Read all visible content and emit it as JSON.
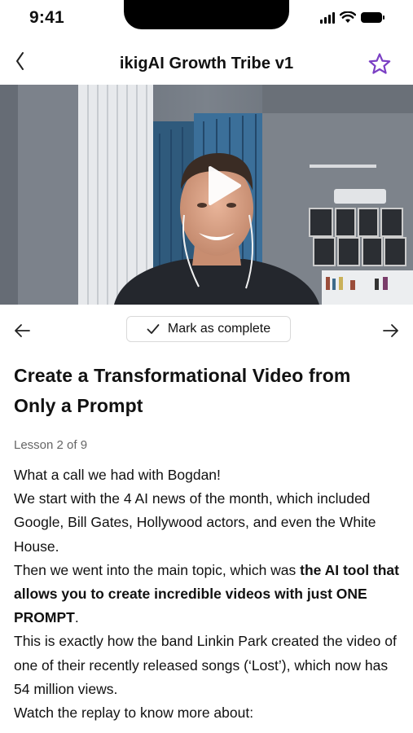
{
  "status_bar": {
    "time": "9:41"
  },
  "nav": {
    "title": "ikigAI Growth Tribe v1"
  },
  "controls": {
    "mark_complete_label": "Mark as complete"
  },
  "lesson": {
    "title": "Create a Transformational Video from Only a Prompt",
    "count": "Lesson 2 of 9",
    "paragraphs": {
      "p1": "What a call we had with Bogdan!",
      "p2": "We start with the 4 AI news of the month, which included Google, Bill Gates, Hollywood actors, and even the White House.",
      "p3_a": "Then we went into the main topic, which was ",
      "p3_bold": "the AI tool that allows you to create incredible videos with just ONE PROMPT",
      "p3_c": ".",
      "p4": "This is exactly how the band Linkin Park created the video of one of their recently released songs (‘Lost’), which now has 54 million views.",
      "p5": "Watch the replay to know more about:"
    }
  },
  "colors": {
    "accent": "#7b3fc4",
    "text": "#111111",
    "muted": "#666666"
  }
}
